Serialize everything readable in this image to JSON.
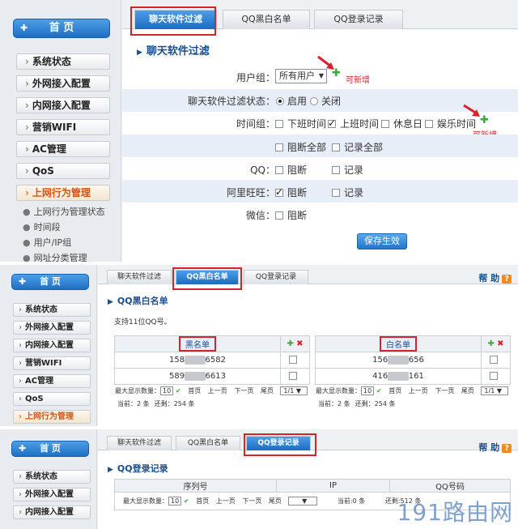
{
  "colors": {
    "accent": "#1d6fc4",
    "highlight_box": "#d4242a",
    "plus": "#3fa83c",
    "active_nav": "#d6540f"
  },
  "sidebar": {
    "home_label": "首 页",
    "items": [
      {
        "label": "系统状态"
      },
      {
        "label": "外网接入配置"
      },
      {
        "label": "内网接入配置"
      },
      {
        "label": "营销WIFI"
      },
      {
        "label": "AC管理"
      },
      {
        "label": "QoS"
      },
      {
        "label": "上网行为管理"
      }
    ],
    "sub_items": [
      {
        "label": "上网行为管理状态"
      },
      {
        "label": "时间段"
      },
      {
        "label": "用户/IP组"
      },
      {
        "label": "网址分类管理"
      }
    ]
  },
  "tabs": [
    {
      "label": "聊天软件过滤"
    },
    {
      "label": "QQ黑白名单"
    },
    {
      "label": "QQ登录记录"
    }
  ],
  "help": {
    "label": "帮 助",
    "icon": "?"
  },
  "filter": {
    "title": "聊天软件过滤",
    "user_group_label": "用户组：",
    "user_group_value": "所有用户",
    "new_tag": "可新增",
    "status_label": "聊天软件过滤状态：",
    "enable": "启用",
    "disable": "关闭",
    "time_group_label": "时间组：",
    "time_groups": [
      "下班时间",
      "上班时间",
      "休息日",
      "娱乐时间"
    ],
    "block_all": "阻断全部",
    "record_all": "记录全部",
    "apps": [
      {
        "name": "QQ：",
        "block": "阻断",
        "record": "记录"
      },
      {
        "name": "阿里旺旺：",
        "block": "阻断",
        "record": "记录"
      },
      {
        "name": "微信：",
        "block": "阻断"
      }
    ],
    "save": "保存生效"
  },
  "blackwhite": {
    "title": "QQ黑白名单",
    "hint": "支持11位QQ号。",
    "black_header": "黑名单",
    "white_header": "白名单",
    "black_rows": [
      {
        "pre": "158",
        "post": "6582"
      },
      {
        "pre": "589",
        "post": "6613"
      }
    ],
    "white_rows": [
      {
        "pre": "156",
        "post": "656"
      },
      {
        "pre": "416",
        "post": "161"
      }
    ],
    "pager": {
      "max_label": "最大显示数量：",
      "max_value": "10",
      "first": "首页",
      "prev": "上一页",
      "next": "下一页",
      "last": "尾页",
      "page_sel": "1/1",
      "current": "当前：2 条",
      "total": "还剩：254 条"
    }
  },
  "loginlog": {
    "title": "QQ登录记录",
    "columns": [
      "序列号",
      "IP",
      "QQ号码"
    ],
    "pager": {
      "max_label": "最大显示数量：",
      "max_value": "10",
      "first": "首页",
      "prev": "上一页",
      "next": "下一页",
      "last": "尾页",
      "current": "当前:0 条",
      "total": "还剩:512 条"
    }
  },
  "watermark": "191路由网"
}
